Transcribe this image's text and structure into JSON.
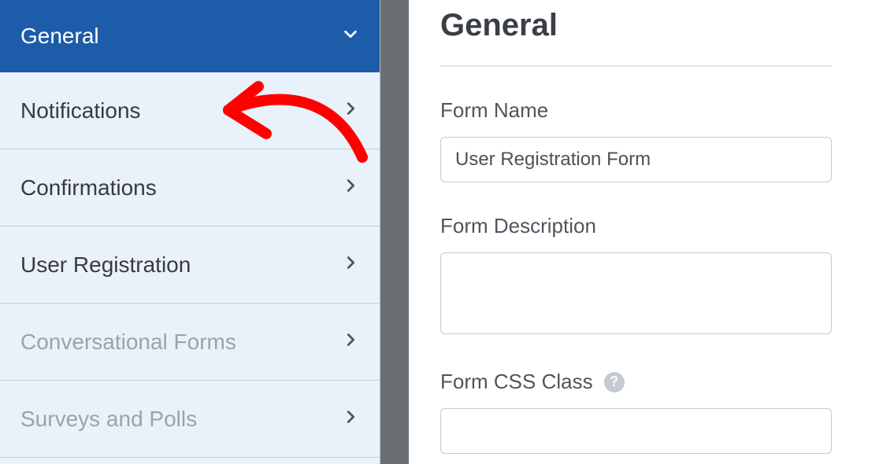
{
  "sidebar": {
    "items": [
      {
        "label": "General",
        "active": true,
        "disabled": false,
        "icon": "down"
      },
      {
        "label": "Notifications",
        "active": false,
        "disabled": false,
        "icon": "right"
      },
      {
        "label": "Confirmations",
        "active": false,
        "disabled": false,
        "icon": "right"
      },
      {
        "label": "User Registration",
        "active": false,
        "disabled": false,
        "icon": "right"
      },
      {
        "label": "Conversational Forms",
        "active": false,
        "disabled": true,
        "icon": "right"
      },
      {
        "label": "Surveys and Polls",
        "active": false,
        "disabled": true,
        "icon": "right"
      }
    ]
  },
  "main": {
    "title": "General",
    "form_name": {
      "label": "Form Name",
      "value": "User Registration Form"
    },
    "form_description": {
      "label": "Form Description",
      "value": ""
    },
    "form_css_class": {
      "label": "Form CSS Class",
      "value": ""
    }
  },
  "annotation": {
    "color": "#ff0000"
  }
}
